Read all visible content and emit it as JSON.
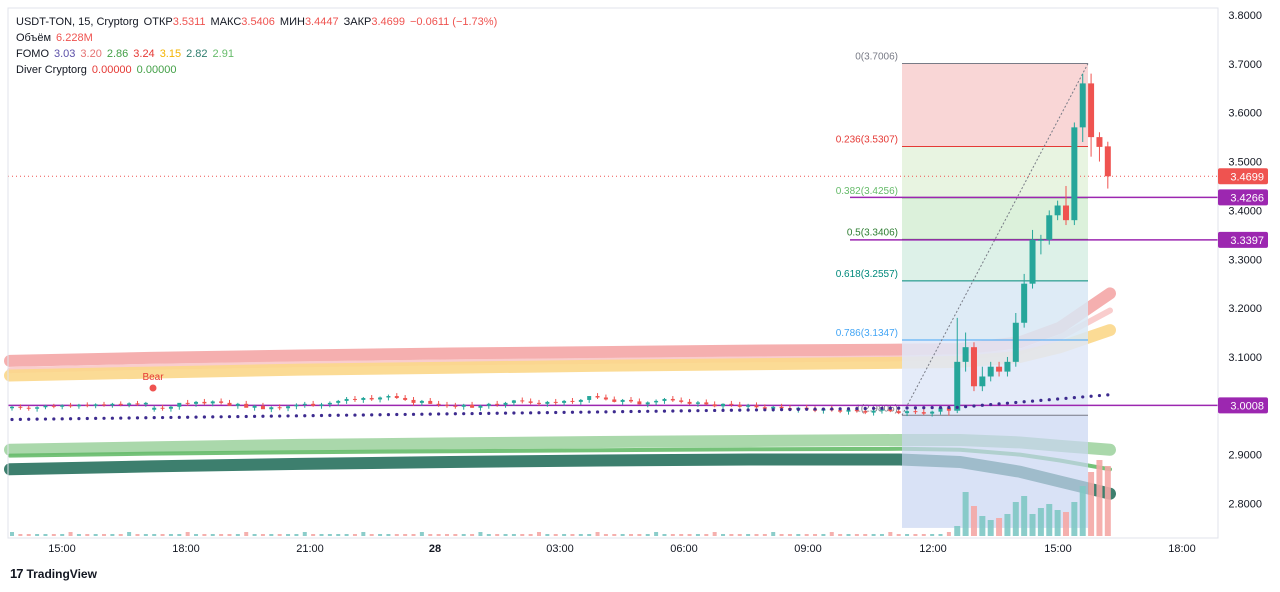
{
  "header": {
    "symbol": "USDT-TON, 15, Cryptorg",
    "open_label": "ОТКР",
    "open": "3.5311",
    "high_label": "МАКС",
    "high": "3.5406",
    "low_label": "МИН",
    "low": "3.4447",
    "close_label": "ЗАКР",
    "close": "3.4699",
    "change": "−0.0611 (−1.73%)"
  },
  "indicators": {
    "volume_label": "Объём",
    "volume_value": "6.228M",
    "fomo_label": "FOMO",
    "fomo_values": [
      "3.03",
      "3.20",
      "2.86",
      "3.24",
      "3.15",
      "2.82",
      "2.91"
    ],
    "diver_label": "Diver Cryptorg",
    "diver_values": [
      "0.00000",
      "0.00000"
    ]
  },
  "footer": {
    "brand": "TradingView"
  },
  "colors": {
    "up": "#26a69a",
    "down": "#ef5350",
    "level": "#9c27b0",
    "fomo": [
      "#5b4fa8",
      "#e57373",
      "#43a047",
      "#e53935",
      "#f4b400",
      "#2e7d6e",
      "#66bb6a"
    ],
    "diver": [
      "#e53935",
      "#43a047"
    ]
  },
  "chart_data": {
    "type": "candlestick",
    "y_axis": {
      "min": 2.75,
      "max": 3.8,
      "ticks": [
        "2.8000",
        "2.9000",
        "3.0000",
        "3.1000",
        "3.2000",
        "3.3000",
        "3.4000",
        "3.5000",
        "3.6000",
        "3.7000",
        "3.8000"
      ]
    },
    "x_axis": {
      "ticks": [
        "15:00",
        "18:00",
        "21:00",
        "28",
        "03:00",
        "06:00",
        "09:00",
        "12:00",
        "15:00",
        "18:00"
      ]
    },
    "price_labels": [
      {
        "text": "3.4699",
        "value": 3.4699,
        "color": "#ef5350"
      },
      {
        "text": "3.4266",
        "value": 3.4266,
        "color": "#9c27b0"
      },
      {
        "text": "3.3397",
        "value": 3.3397,
        "color": "#9c27b0"
      },
      {
        "text": "3.0008",
        "value": 3.0008,
        "color": "#9c27b0"
      }
    ],
    "horizontal_levels": [
      3.4266,
      3.3397,
      3.0008
    ],
    "fibonacci": [
      {
        "label": "0(3.7006)",
        "value": 3.7006,
        "color": "#787b86"
      },
      {
        "label": "0.236(3.5307)",
        "value": 3.5307,
        "color": "#e53935"
      },
      {
        "label": "0.382(3.4256)",
        "value": 3.4256,
        "color": "#66bb6a"
      },
      {
        "label": "0.5(3.3406)",
        "value": 3.3406,
        "color": "#2e7d32"
      },
      {
        "label": "0.618(3.2557)",
        "value": 3.2557,
        "color": "#00897b"
      },
      {
        "label": "0.786(3.1347)",
        "value": 3.1347,
        "color": "#42a5f5"
      },
      {
        "label": "1(2.9806)",
        "value": 2.9806,
        "color": "#787b86"
      }
    ],
    "signal": {
      "label": "Bear",
      "time_index": 29,
      "value": 3.03
    },
    "candles": [
      [
        2.995,
        3.0,
        2.99,
        2.998
      ],
      [
        2.998,
        3.003,
        2.992,
        2.996
      ],
      [
        2.996,
        3.0,
        2.99,
        2.994
      ],
      [
        2.994,
        2.999,
        2.988,
        2.997
      ],
      [
        2.997,
        3.002,
        2.993,
        3.0
      ],
      [
        3.0,
        3.004,
        2.995,
        2.998
      ],
      [
        2.998,
        3.003,
        2.993,
        3.001
      ],
      [
        3.001,
        3.006,
        2.996,
        2.999
      ],
      [
        2.999,
        3.004,
        2.994,
        3.002
      ],
      [
        3.002,
        3.007,
        2.997,
        3.0
      ],
      [
        3.0,
        3.005,
        2.995,
        3.003
      ],
      [
        3.003,
        3.008,
        2.998,
        3.001
      ],
      [
        3.001,
        3.006,
        2.996,
        3.004
      ],
      [
        3.004,
        3.009,
        2.999,
        3.002
      ],
      [
        3.002,
        3.007,
        2.997,
        3.005
      ],
      [
        3.005,
        3.01,
        3.0,
        3.003
      ],
      [
        3.003,
        3.008,
        2.998,
        3.006
      ],
      [
        2.992,
        3.0,
        2.988,
        2.996
      ],
      [
        2.996,
        3.002,
        2.99,
        2.994
      ],
      [
        2.994,
        3.0,
        2.988,
        2.998
      ],
      [
        2.998,
        3.004,
        2.992,
        3.006
      ],
      [
        3.006,
        3.012,
        3.0,
        3.004
      ],
      [
        3.004,
        3.01,
        2.998,
        3.008
      ],
      [
        3.008,
        3.014,
        3.002,
        3.005
      ],
      [
        3.005,
        3.011,
        2.999,
        3.009
      ],
      [
        3.009,
        3.015,
        3.003,
        3.006
      ],
      [
        3.006,
        3.012,
        3.0,
        3.0
      ],
      [
        3.0,
        3.006,
        2.994,
        3.004
      ],
      [
        3.004,
        3.01,
        2.998,
        2.996
      ],
      [
        2.996,
        3.002,
        2.99,
        3.0
      ],
      [
        3.0,
        3.006,
        2.994,
        2.993
      ],
      [
        2.993,
        2.999,
        2.987,
        2.997
      ],
      [
        2.997,
        3.003,
        2.991,
        2.995
      ],
      [
        2.995,
        3.001,
        2.989,
        2.999
      ],
      [
        2.999,
        3.005,
        2.993,
        3.002
      ],
      [
        3.002,
        3.008,
        2.996,
        3.004
      ],
      [
        3.004,
        3.01,
        2.998,
        3.0
      ],
      [
        3.0,
        3.006,
        2.994,
        3.003
      ],
      [
        3.003,
        3.009,
        2.997,
        3.006
      ],
      [
        3.006,
        3.012,
        3.0,
        3.01
      ],
      [
        3.01,
        3.018,
        3.004,
        3.014
      ],
      [
        3.014,
        3.02,
        3.008,
        3.012
      ],
      [
        3.012,
        3.018,
        3.006,
        3.016
      ],
      [
        3.016,
        3.022,
        3.01,
        3.013
      ],
      [
        3.013,
        3.019,
        3.007,
        3.017
      ],
      [
        3.017,
        3.023,
        3.011,
        3.02
      ],
      [
        3.02,
        3.026,
        3.014,
        3.016
      ],
      [
        3.016,
        3.022,
        3.01,
        3.012
      ],
      [
        3.012,
        3.018,
        3.0,
        3.006
      ],
      [
        3.006,
        3.012,
        3.0,
        3.01
      ],
      [
        3.01,
        3.016,
        3.004,
        3.004
      ],
      [
        3.004,
        3.01,
        2.998,
        3.002
      ],
      [
        3.002,
        3.008,
        2.996,
        3.0
      ],
      [
        3.0,
        3.006,
        2.994,
        2.998
      ],
      [
        2.998,
        3.004,
        2.992,
        3.002
      ],
      [
        3.002,
        3.008,
        2.996,
        2.996
      ],
      [
        2.996,
        3.002,
        2.99,
        3.0
      ],
      [
        3.0,
        3.006,
        2.994,
        3.004
      ],
      [
        3.004,
        3.01,
        2.998,
        3.002
      ],
      [
        3.002,
        3.008,
        2.996,
        3.006
      ],
      [
        3.006,
        3.012,
        3.0,
        3.011
      ],
      [
        3.011,
        3.017,
        3.005,
        3.009
      ],
      [
        3.009,
        3.015,
        3.003,
        3.006
      ],
      [
        3.006,
        3.012,
        3.0,
        3.004
      ],
      [
        3.004,
        3.01,
        2.998,
        3.008
      ],
      [
        3.008,
        3.014,
        3.002,
        3.006
      ],
      [
        3.006,
        3.012,
        3.0,
        3.01
      ],
      [
        3.01,
        3.016,
        3.004,
        3.008
      ],
      [
        3.008,
        3.014,
        3.002,
        3.012
      ],
      [
        3.012,
        3.018,
        3.006,
        3.02
      ],
      [
        3.02,
        3.026,
        3.014,
        3.017
      ],
      [
        3.017,
        3.023,
        3.011,
        3.013
      ],
      [
        3.013,
        3.019,
        3.007,
        3.008
      ],
      [
        3.008,
        3.014,
        3.002,
        3.012
      ],
      [
        3.012,
        3.018,
        3.006,
        3.009
      ],
      [
        3.009,
        3.015,
        3.003,
        3.003
      ],
      [
        3.003,
        3.009,
        2.997,
        3.007
      ],
      [
        3.007,
        3.013,
        3.001,
        3.01
      ],
      [
        3.01,
        3.016,
        3.004,
        3.014
      ],
      [
        3.014,
        3.02,
        3.008,
        3.011
      ],
      [
        3.011,
        3.017,
        3.005,
        3.008
      ],
      [
        3.008,
        3.014,
        3.002,
        3.004
      ],
      [
        3.004,
        3.01,
        2.998,
        3.007
      ],
      [
        3.007,
        3.013,
        3.001,
        3.003
      ],
      [
        3.003,
        3.009,
        2.997,
        2.999
      ],
      [
        2.999,
        3.005,
        2.993,
        3.004
      ],
      [
        3.004,
        3.01,
        2.998,
        3.002
      ],
      [
        3.002,
        3.008,
        2.996,
        2.998
      ],
      [
        2.998,
        3.004,
        2.992,
        3.001
      ],
      [
        3.001,
        3.007,
        2.995,
        2.997
      ],
      [
        2.997,
        3.003,
        2.991,
        2.994
      ],
      [
        2.994,
        3.0,
        2.988,
        2.998
      ],
      [
        2.998,
        3.004,
        2.992,
        2.995
      ],
      [
        2.995,
        3.001,
        2.989,
        2.992
      ],
      [
        2.992,
        2.998,
        2.986,
        2.996
      ],
      [
        2.996,
        3.002,
        2.99,
        2.993
      ],
      [
        2.993,
        2.999,
        2.987,
        2.99
      ],
      [
        2.99,
        2.996,
        2.984,
        2.994
      ],
      [
        2.994,
        3.0,
        2.988,
        2.991
      ],
      [
        2.991,
        2.997,
        2.985,
        2.988
      ],
      [
        2.988,
        2.994,
        2.982,
        2.992
      ],
      [
        2.992,
        2.998,
        2.986,
        2.989
      ],
      [
        2.989,
        2.995,
        2.983,
        2.986
      ],
      [
        2.986,
        2.992,
        2.98,
        2.99
      ],
      [
        2.99,
        2.996,
        2.984,
        2.993
      ],
      [
        2.993,
        2.999,
        2.987,
        2.989
      ],
      [
        2.989,
        2.995,
        2.983,
        2.985
      ],
      [
        2.985,
        2.991,
        2.979,
        2.989
      ],
      [
        2.989,
        2.995,
        2.983,
        2.987
      ],
      [
        2.987,
        2.993,
        2.981,
        2.984
      ],
      [
        2.984,
        2.99,
        2.978,
        2.988
      ],
      [
        2.988,
        2.994,
        2.982,
        2.996
      ],
      [
        2.996,
        3.0,
        2.98,
        2.99
      ],
      [
        2.99,
        3.18,
        2.985,
        3.09
      ],
      [
        3.09,
        3.15,
        3.07,
        3.12
      ],
      [
        3.12,
        3.13,
        3.03,
        3.04
      ],
      [
        3.04,
        3.08,
        3.03,
        3.06
      ],
      [
        3.06,
        3.09,
        3.05,
        3.08
      ],
      [
        3.08,
        3.09,
        3.06,
        3.07
      ],
      [
        3.07,
        3.1,
        3.06,
        3.09
      ],
      [
        3.09,
        3.19,
        3.08,
        3.17
      ],
      [
        3.17,
        3.27,
        3.16,
        3.25
      ],
      [
        3.25,
        3.36,
        3.24,
        3.34
      ],
      [
        3.34,
        3.35,
        3.31,
        3.34
      ],
      [
        3.34,
        3.4,
        3.33,
        3.39
      ],
      [
        3.39,
        3.42,
        3.38,
        3.41
      ],
      [
        3.41,
        3.45,
        3.37,
        3.38
      ],
      [
        3.38,
        3.58,
        3.37,
        3.57
      ],
      [
        3.57,
        3.68,
        3.54,
        3.66
      ],
      [
        3.66,
        3.68,
        3.51,
        3.55
      ],
      [
        3.55,
        3.56,
        3.5,
        3.53
      ],
      [
        3.5311,
        3.5406,
        3.4447,
        3.4699
      ]
    ]
  }
}
